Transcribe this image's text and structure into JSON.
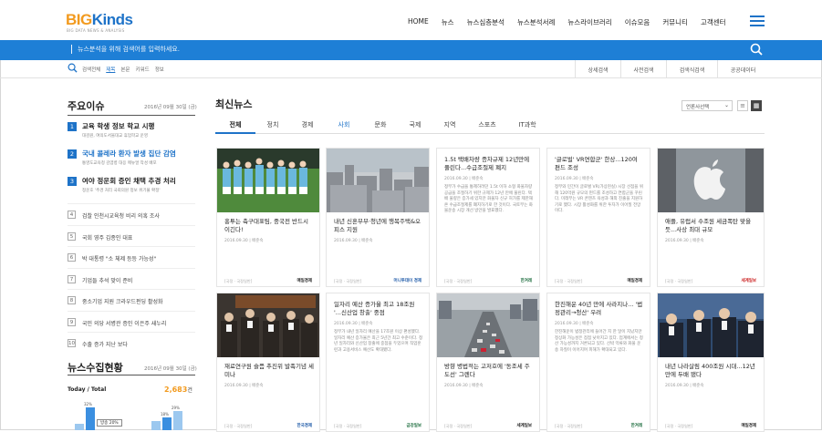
{
  "header": {
    "logo_big": "BIG",
    "logo_kinds": "Kinds",
    "logo_sub": "BIG DATA NEWS & ANALYSIS",
    "nav": [
      "HOME",
      "뉴스",
      "뉴스심층분석",
      "뉴스분석서례",
      "뉴스라이브러리",
      "이슈모음",
      "커뮤니티",
      "고객센터"
    ]
  },
  "search": {
    "placeholder": "뉴스분석을 위해 검색어를 입력하세요."
  },
  "subbar": {
    "options": [
      "검색전체",
      "제목",
      "본문",
      "키워드",
      "정보"
    ],
    "buttons": [
      "상세검색",
      "사전검색",
      "검색식검색",
      "공공데이터"
    ]
  },
  "issues": {
    "title": "주요이슈",
    "date": "2016년 09월 30일 (금)",
    "big": [
      {
        "num": "1",
        "title": "교육 학생 정보 학교 시행",
        "sub": "대검원, 여의도서울대교 휴업학교 운영"
      },
      {
        "num": "2",
        "title": "국내 콜레라 환자 발생 집단 감염",
        "sub": "통영도교육청 감염병 대응 메뉴얼 작성 배포"
      },
      {
        "num": "3",
        "title": "여야 정운회 증인 채택 추경 처리",
        "sub": "정운호 '추경 처리 국회의원 정보 위기불 확정'"
      }
    ],
    "small": [
      {
        "num": "4",
        "title": "검찰 인천시교육청 비리 의혹 조사"
      },
      {
        "num": "5",
        "title": "국회 영주 김종인 대표"
      },
      {
        "num": "6",
        "title": "박 대통령 \"소 체제 등등 가능성\""
      },
      {
        "num": "7",
        "title": "기업들 추석 맞이 준비"
      },
      {
        "num": "8",
        "title": "중소기업 지원 크라우드펀딩 활성화"
      },
      {
        "num": "9",
        "title": "국민 의당 서병관 증인 이은주 새누리"
      },
      {
        "num": "10",
        "title": "수출 증가 지난 보다"
      }
    ]
  },
  "stats": {
    "title": "뉴스수집현황",
    "date": "2016년 09월 30일 (금)",
    "label": "Today / Total",
    "today": "2,683",
    "unit": "건",
    "bar_values": [
      0.25,
      0.95,
      0.4,
      0.55,
      0.8
    ],
    "bar_labels": [
      "",
      "32%",
      "",
      "18%",
      "29%"
    ],
    "box_label": "방송 20%"
  },
  "main": {
    "title": "최신뉴스",
    "sort_label": "언론사선택",
    "tabs": [
      "전체",
      "정치",
      "경제",
      "사회",
      "문화",
      "국제",
      "지역",
      "스포츠",
      "IT과학"
    ],
    "active_tab": 0,
    "cards_row1": [
      {
        "title": "홍투는 축구대표팀, 중국전 반드시 이긴다!",
        "date": "2016.09.30 | 배준숙",
        "cat": "[국정 · 국정일반]",
        "src": "매일경제"
      },
      {
        "title": "내년 신혼부부·청년에 행복주택&오피스 지원",
        "date": "2016.09.30 | 배준숙",
        "cat": "[국정 · 국정일반]",
        "src": "머니투데이 경제"
      },
      {
        "title": "1.5t 택배차량 증차규제 12년만에 풀린다...수급조절제 폐지",
        "date": "2016.09.30 | 배준숙",
        "body": "정부가 수급을 통제하려던 1.5t 이하 소형 화물차량 공급을 조절하기 위한 규제가 12년 만에 풀린다. 택배 물량은 증가세 있지만 화물차 신규 허가를 제한해 온 수급조절제를 폐지하기로 한 것이다. 국토부는 화물운송 시장 개선 방안을 발표했다.",
        "cat": "[국정 · 국정일반]",
        "src": "한겨레"
      },
      {
        "title": "'글로벌' VR연합군' 한상...120여 편드 조성",
        "date": "2016.09.30 | 배준숙",
        "body": "정부와 민간이 글로벌 VR(가상현실) 시장 선점을 위해 120억원 규모의 펀드를 조성하고 연합군을 꾸린다. 미래부는 VR 콘텐츠 육성과 해외 진출을 지원하기로 했다. 시장 활성화를 위한 투자가 이어질 전망이다.",
        "cat": "[국정 · 국정일반]",
        "src": "매일경제"
      },
      {
        "title": "애플, 유럽서 수조원 세금폭탄 맞을 듯...사상 최대 규모",
        "date": "2016.09.30 | 배준숙",
        "cat": "[국정 · 국정일반]",
        "src": "세계일보"
      }
    ],
    "cards_row2": [
      {
        "title": "재료연구원 슬픔 추진위 발족기념 세미나",
        "date": "2016.09.30 | 배준숙",
        "cat": "[국정 · 국정일반]",
        "src": "한국경제"
      },
      {
        "title": "일자리 예산 증가율 최고 18조원 '...신산업 창출' 중점",
        "date": "2016.09.30 | 배준숙",
        "body": "정부가 내년 일자리 예산을 17조원 이상 편성했다. 일자리 예산 증가율은 최근 5년간 최고 수준이다. 청년 일자리와 신산업 창출에 중점을 두었으며 직업훈련과 고용서비스 예산도 확대됐다.",
        "cat": "[국정 · 국정일반]",
        "src": "금강일보"
      },
      {
        "title": "방향 병법적는 고저호에 '동조세 주도선' 그렌다",
        "date": "2016.09.30 | 배준숙",
        "cat": "[국정 · 국정일반]",
        "src": "세계일보"
      },
      {
        "title": "한진해운 40년 만에 사라지나... '법정관리→청산' 우려",
        "date": "2016.09.30 | 배준숙",
        "body": "한진해운이 법정관리에 들어간 지 한 달이 지났지만 정상화 가능성은 점점 낮아지고 있다. 업계에서는 청산 가능성까지 거론되고 있다. 선박 억류와 화물 운송 차질이 이어지며 피해가 확대되고 있다.",
        "cat": "[국정 · 국정일반]",
        "src": "한겨레"
      },
      {
        "title": "내년 나라살림 400조원 시대...12년만에 두배 됐다",
        "date": "2016.09.30 | 배준숙",
        "cat": "[국정 · 국정일반]",
        "src": "매일경제"
      }
    ]
  },
  "colors": {
    "accent": "#1e7fd6",
    "logo_orange": "#f29a1e"
  }
}
